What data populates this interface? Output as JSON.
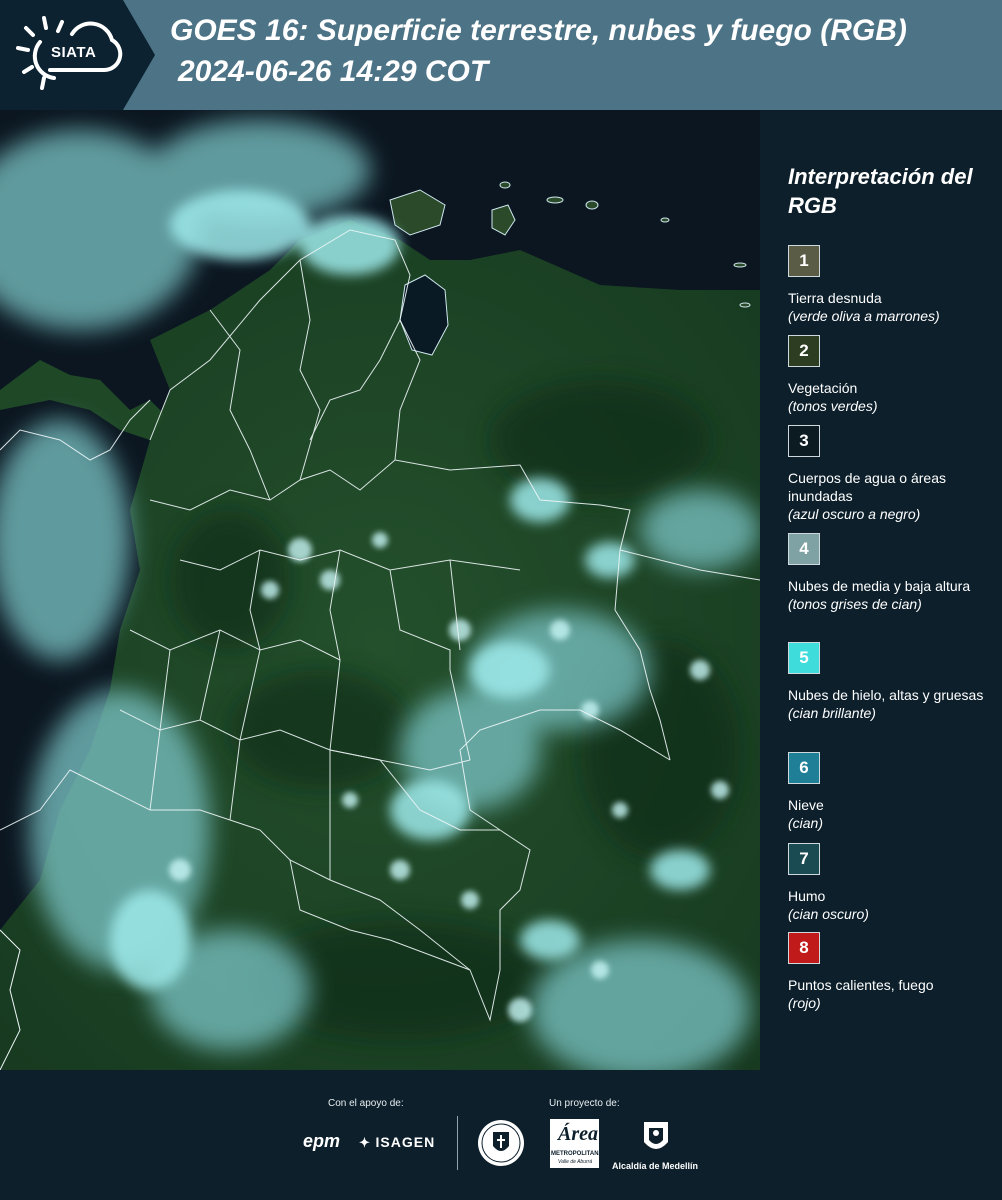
{
  "header": {
    "logo_text": "SIATA",
    "title_line1": "GOES 16: Superficie terrestre, nubes y fuego (RGB)",
    "title_line2": "2024-06-26 14:29 COT"
  },
  "map": {
    "icon": "satellite-rgb-image"
  },
  "legend": {
    "title": "Interpretación del RGB",
    "items": [
      {
        "number": "1",
        "label": "Tierra desnuda",
        "note": "(verde oliva a marrones)",
        "color": "#5b5c45"
      },
      {
        "number": "2",
        "label": "Vegetación",
        "note": "(tonos verdes)",
        "color": "#2d3d22"
      },
      {
        "number": "3",
        "label": "Cuerpos de agua o áreas inundadas",
        "note": "(azul oscuro a negro)",
        "color": "#0c1a22"
      },
      {
        "number": "4",
        "label": "Nubes de media y baja altura",
        "note": "(tonos grises de cian)",
        "color": "#7fa3a4"
      },
      {
        "number": "5",
        "label": "Nubes de hielo, altas y gruesas",
        "note": "(cian brillante)",
        "color": "#3fdcdc"
      },
      {
        "number": "6",
        "label": "Nieve",
        "note": "(cian)",
        "color": "#1f7f96"
      },
      {
        "number": "7",
        "label": "Humo",
        "note": "(cian oscuro)",
        "color": "#1a4a52"
      },
      {
        "number": "8",
        "label": "Puntos calientes, fuego",
        "note": "(rojo)",
        "color": "#c01a1a"
      }
    ]
  },
  "footer": {
    "support_caption": "Con el apoyo de:",
    "project_caption": "Un proyecto de:",
    "sponsor_epm": "epm",
    "sponsor_isagen": "ISAGEN",
    "area_logo_text": "Área",
    "area_logo_sub1": "METROPOLITANA",
    "area_logo_sub2": "Valle de Aburrá",
    "alcaldia": "Alcaldía de Medellín"
  }
}
